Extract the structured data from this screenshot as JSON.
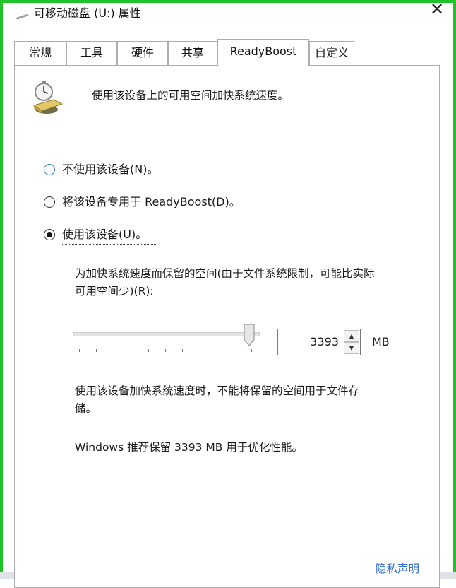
{
  "window": {
    "title": "可移动磁盘 (U:) 属性",
    "close_label": "✕"
  },
  "tabs": [
    {
      "label": "常规"
    },
    {
      "label": "工具"
    },
    {
      "label": "硬件"
    },
    {
      "label": "共享"
    },
    {
      "label": "ReadyBoost",
      "active": true
    },
    {
      "label": "自定义"
    }
  ],
  "content": {
    "description": "使用该设备上的可用空间加快系统速度。",
    "options": [
      {
        "label": "不使用该设备(N)。",
        "checked": false
      },
      {
        "label": "将该设备专用于 ReadyBoost(D)。",
        "checked": false
      },
      {
        "label": "使用该设备(U)。",
        "checked": true
      }
    ],
    "reserve_label_line1": "为加快系统速度而保留的空间(由于文件系统限制，可能比实际",
    "reserve_label_line2": "可用空间少)(R):",
    "slider_fraction": 0.94,
    "reserve_value": "3393",
    "unit": "MB",
    "warning_line1": "使用该设备加快系统速度时，不能将保留的空间用于文件存",
    "warning_line2": "储。",
    "recommendation": "Windows 推荐保留 3393 MB 用于优化性能。"
  },
  "footer": {
    "privacy_link": "隐私声明"
  },
  "colors": {
    "window_border": "#21c12a",
    "link": "#2b6cc4"
  }
}
